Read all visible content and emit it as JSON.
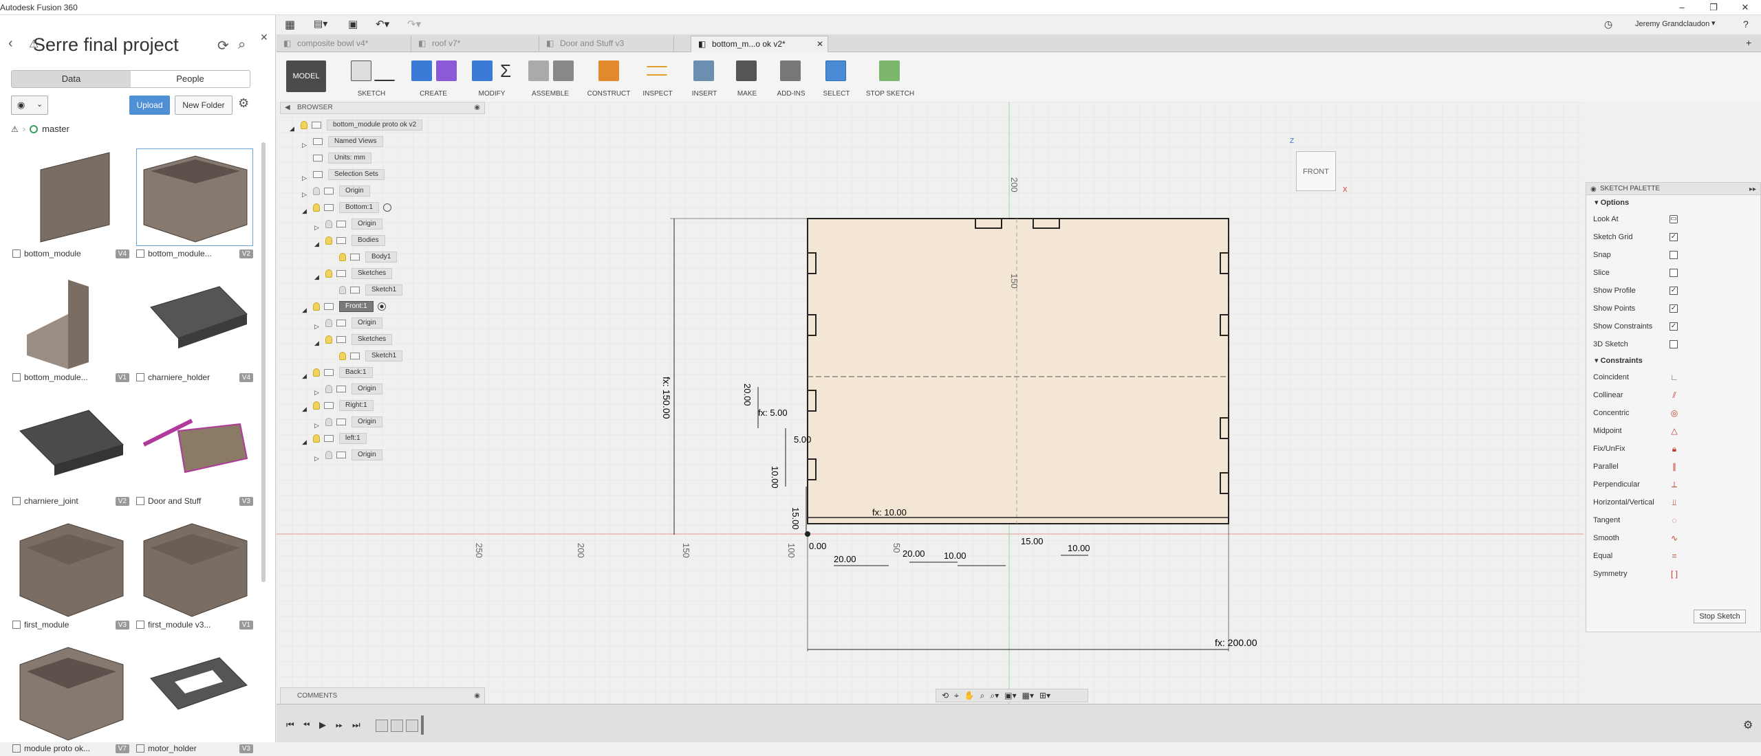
{
  "window": {
    "title": "Autodesk Fusion 360",
    "minimize": "‒",
    "maximize": "❐",
    "close": "✕"
  },
  "data_panel": {
    "project": "Serre final project",
    "tabs": [
      "Data",
      "People"
    ],
    "upload": "Upload",
    "new_folder": "New Folder",
    "branch": "master",
    "items": [
      {
        "name": "bottom_module",
        "version": "V4"
      },
      {
        "name": "bottom_module...",
        "version": "V2"
      },
      {
        "name": "bottom_module...",
        "version": "V1"
      },
      {
        "name": "charniere_holder",
        "version": "V4"
      },
      {
        "name": "charniere_joint",
        "version": "V2"
      },
      {
        "name": "Door and Stuff",
        "version": "V3"
      },
      {
        "name": "first_module",
        "version": "V3"
      },
      {
        "name": "first_module v3...",
        "version": "V1"
      },
      {
        "name": "module proto ok...",
        "version": "V7"
      },
      {
        "name": "motor_holder",
        "version": "V3"
      }
    ]
  },
  "top_right": {
    "user": "Jeremy Grandclaudon"
  },
  "doc_tabs": [
    {
      "label": "composite bowl v4*"
    },
    {
      "label": "roof v7*"
    },
    {
      "label": "Door and Stuff v3"
    },
    {
      "label": "bottom_m...o ok v2*"
    }
  ],
  "toolbar": {
    "mode": "MODEL",
    "groups": [
      "SKETCH",
      "CREATE",
      "MODIFY",
      "ASSEMBLE",
      "CONSTRUCT",
      "INSPECT",
      "INSERT",
      "MAKE",
      "ADD-INS",
      "SELECT",
      "STOP SKETCH"
    ]
  },
  "browser": {
    "title": "BROWSER",
    "rows": [
      {
        "label": "bottom_module proto ok v2"
      },
      {
        "label": "Named Views"
      },
      {
        "label": "Units: mm"
      },
      {
        "label": "Selection Sets"
      },
      {
        "label": "Origin"
      },
      {
        "label": "Bottom:1"
      },
      {
        "label": "Origin"
      },
      {
        "label": "Bodies"
      },
      {
        "label": "Body1"
      },
      {
        "label": "Sketches"
      },
      {
        "label": "Sketch1"
      },
      {
        "label": "Front:1"
      },
      {
        "label": "Origin"
      },
      {
        "label": "Sketches"
      },
      {
        "label": "Sketch1"
      },
      {
        "label": "Back:1"
      },
      {
        "label": "Origin"
      },
      {
        "label": "Right:1"
      },
      {
        "label": "Origin"
      },
      {
        "label": "left:1"
      },
      {
        "label": "Origin"
      }
    ]
  },
  "viewcube": {
    "face": "FRONT",
    "z": "Z",
    "x": "X"
  },
  "sketch_palette": {
    "title": "SKETCH PALETTE",
    "options_header": "Options",
    "options": [
      {
        "label": "Look At",
        "checked": null
      },
      {
        "label": "Sketch Grid",
        "checked": true
      },
      {
        "label": "Snap",
        "checked": false
      },
      {
        "label": "Slice",
        "checked": false
      },
      {
        "label": "Show Profile",
        "checked": true
      },
      {
        "label": "Show Points",
        "checked": true
      },
      {
        "label": "Show Constraints",
        "checked": true
      },
      {
        "label": "3D Sketch",
        "checked": false
      }
    ],
    "constraints_header": "Constraints",
    "constraints": [
      "Coincident",
      "Collinear",
      "Concentric",
      "Midpoint",
      "Fix/UnFix",
      "Parallel",
      "Perpendicular",
      "Horizontal/Vertical",
      "Tangent",
      "Smooth",
      "Equal",
      "Symmetry"
    ],
    "stop": "Stop Sketch"
  },
  "dimensions": {
    "d150": "fx: 150.00",
    "d20": "20.00",
    "d5": "fx: 5.00",
    "d5b": "5.00",
    "d10v": "10.00",
    "d15v": "15.00",
    "d200": "fx: 200.00",
    "d20a": "20.00",
    "d20b": "20.00",
    "d10a": "10.00",
    "d10b": "10.00",
    "d10c": "10.00",
    "d15a": "15.00",
    "fx10": "fx: 10.00",
    "zero": "0.00",
    "a250": "250",
    "a200": "200",
    "a150": "150",
    "a150b": "150",
    "a100": "100",
    "a50": "50",
    "top200": "200",
    "top150": "150"
  },
  "comments": {
    "title": "COMMENTS"
  }
}
